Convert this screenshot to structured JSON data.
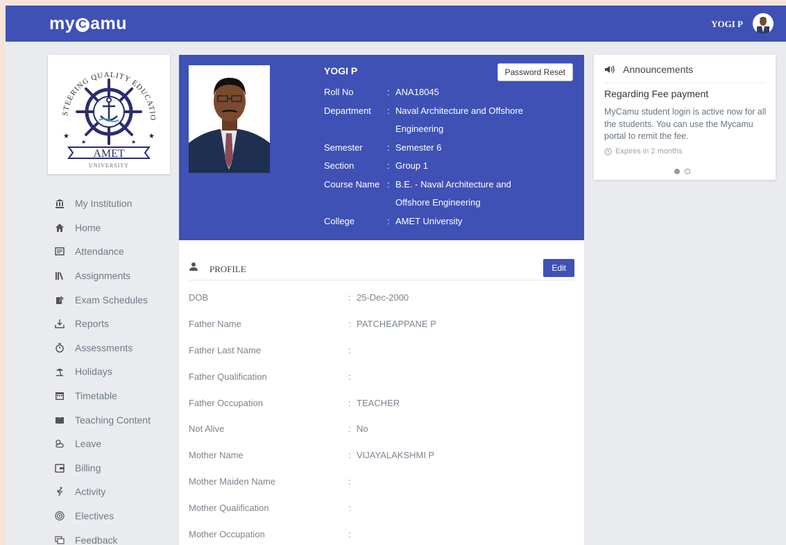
{
  "header": {
    "logo_pre": "my",
    "logo_c": "C",
    "logo_post": "amu",
    "user_name": "YOGI P"
  },
  "institution": {
    "arc_top": "STEERING QUALITY EDUCATION",
    "name": "AMET",
    "sub": "UNIVERSITY"
  },
  "nav": [
    {
      "label": "My Institution",
      "icon": "institution-icon"
    },
    {
      "label": "Home",
      "icon": "home-icon"
    },
    {
      "label": "Attendance",
      "icon": "attendance-icon"
    },
    {
      "label": "Assignments",
      "icon": "assignments-icon"
    },
    {
      "label": "Exam Schedules",
      "icon": "exam-icon"
    },
    {
      "label": "Reports",
      "icon": "download-icon"
    },
    {
      "label": "Assessments",
      "icon": "timer-icon"
    },
    {
      "label": "Holidays",
      "icon": "beach-icon"
    },
    {
      "label": "Timetable",
      "icon": "calendar-icon"
    },
    {
      "label": "Teaching Content",
      "icon": "book-icon"
    },
    {
      "label": "Leave",
      "icon": "weather-icon"
    },
    {
      "label": "Billing",
      "icon": "wallet-icon"
    },
    {
      "label": "Activity",
      "icon": "run-icon"
    },
    {
      "label": "Electives",
      "icon": "target-icon"
    },
    {
      "label": "Feedback",
      "icon": "feedback-icon"
    }
  ],
  "profile_header": {
    "name": "YOGI P",
    "password_reset": "Password Reset",
    "rows": [
      {
        "key": "Roll No",
        "value": "ANA18045",
        "cont": ""
      },
      {
        "key": "Department",
        "value": "Naval Architecture and Offshore",
        "cont": "Engineering"
      },
      {
        "key": "Semester",
        "value": "Semester 6",
        "cont": ""
      },
      {
        "key": "Section",
        "value": "Group 1",
        "cont": ""
      },
      {
        "key": "Course Name",
        "value": "B.E. - Naval Architecture and",
        "cont": "Offshore Engineering"
      },
      {
        "key": "College",
        "value": "AMET University",
        "cont": ""
      }
    ]
  },
  "profile": {
    "title": "PROFILE",
    "edit": "Edit",
    "fields": [
      {
        "key": "DOB",
        "value": "25-Dec-2000"
      },
      {
        "key": "Father Name",
        "value": "PATCHEAPPANE P"
      },
      {
        "key": "Father Last Name",
        "value": ""
      },
      {
        "key": "Father Qualification",
        "value": ""
      },
      {
        "key": "Father Occupation",
        "value": "TEACHER"
      },
      {
        "key": "Not Alive",
        "value": "No"
      },
      {
        "key": "Mother Name",
        "value": "VIJAYALAKSHMI P"
      },
      {
        "key": "Mother Maiden Name",
        "value": ""
      },
      {
        "key": "Mother Qualification",
        "value": ""
      },
      {
        "key": "Mother Occupation",
        "value": ""
      }
    ]
  },
  "announcements": {
    "heading": "Announcements",
    "title": "Regarding Fee payment",
    "text": "MyCamu student login is active now for all the students. You can use the Mycamu portal to remit the fee.",
    "expires": "Expires in 2 months",
    "slide_count": 2,
    "active_slide": 0
  },
  "colors": {
    "primary": "#3f51b5",
    "background": "#e9ebef",
    "outer": "#f6e3dc"
  }
}
